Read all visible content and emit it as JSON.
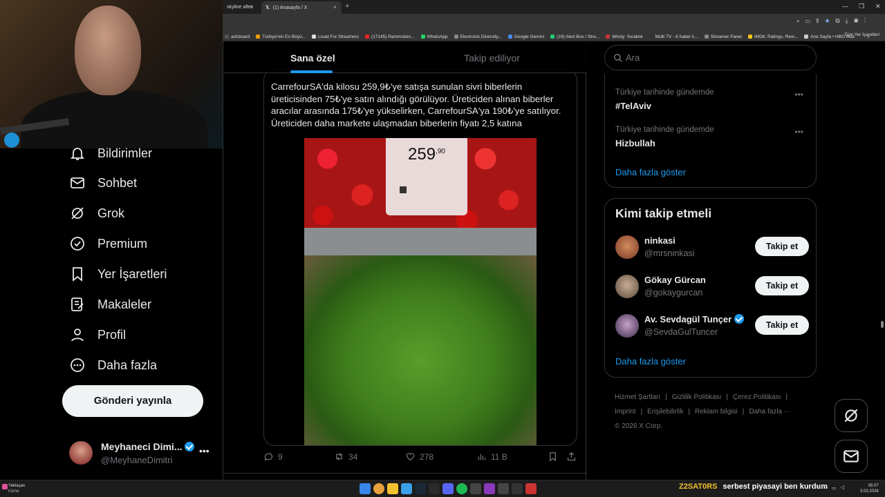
{
  "browser": {
    "tabs": [
      {
        "label": "skyline after",
        "close": "×"
      },
      {
        "label": "(1) Anasayfa / X",
        "close": "×"
      }
    ],
    "new_tab": "+",
    "bookmarks": [
      {
        "label": "ashboard",
        "color": "#555"
      },
      {
        "label": "Türkiye'nin En Büyü...",
        "color": "#f0a000"
      },
      {
        "label": "Livad For Streamers",
        "color": "#ddd"
      },
      {
        "label": "(17145) Rammstein...",
        "color": "#e22"
      },
      {
        "label": "WhatsApp",
        "color": "#25d366"
      },
      {
        "label": "Electronic Diversity...",
        "color": "#888"
      },
      {
        "label": "Google Gemini",
        "color": "#4a8af4"
      },
      {
        "label": "(19) Alert Box / Stre...",
        "color": "#2c7"
      },
      {
        "label": "Windy: Sıcaklık",
        "color": "#c33"
      },
      {
        "label": "Multi TV - 6 haber k...",
        "color": "#333"
      },
      {
        "label": "Streamer Panel",
        "color": "#888"
      },
      {
        "label": "IMDb: Ratings, Revi...",
        "color": "#f5c518"
      },
      {
        "label": "Ana Sayfa • HBO Max",
        "color": "#ccc"
      },
      {
        "label": "»",
        "color": "transparent"
      }
    ],
    "bookmarks_right": "Tüm Yer İşaretleri"
  },
  "sidebar": {
    "items": [
      {
        "label": "Bildirimler",
        "icon": "bell-icon"
      },
      {
        "label": "Sohbet",
        "icon": "mail-icon"
      },
      {
        "label": "Grok",
        "icon": "grok-icon"
      },
      {
        "label": "Premium",
        "icon": "verified-badge-icon"
      },
      {
        "label": "Yer İşaretleri",
        "icon": "bookmark-icon"
      },
      {
        "label": "Makaleler",
        "icon": "article-icon"
      },
      {
        "label": "Profil",
        "icon": "profile-icon"
      },
      {
        "label": "Daha fazla",
        "icon": "more-circle-icon"
      }
    ],
    "post_button": "Gönderi yayınla",
    "account": {
      "name": "Meyhaneci Dimi...",
      "handle": "@MeyhaneDimitri",
      "more": "•••"
    }
  },
  "feed": {
    "tabs": [
      {
        "label": "Sana özel",
        "active": true
      },
      {
        "label": "Takip ediliyor",
        "active": false
      }
    ],
    "quote_text": "CarrefourSA'da kilosu 259,9₺'ye satışa sunulan sivri biberlerin üreticisinden 75₺'ye satın alındığı görülüyor. Üreticiden alınan biberler aracılar arasında 175₺'ye yükselirken, CarrefourSA'ya 190₺'ye satılıyor. Üreticiden daha markete ulaşmadan biberlerin fiyatı 2,5 katına",
    "price_tag": {
      "main": "259",
      "cents": ",90"
    },
    "actions": {
      "replies": "9",
      "reposts": "34",
      "likes": "278",
      "views": "11 B"
    }
  },
  "right": {
    "search_placeholder": "Ara",
    "trends": [
      {
        "context": "Türkiye tarihinde gündemde",
        "name": "#TelAviv",
        "more": "•••"
      },
      {
        "context": "Türkiye tarihinde gündemde",
        "name": "Hizbullah",
        "more": "•••"
      }
    ],
    "trends_show_more": "Daha fazla göster",
    "who_to_follow": {
      "title": "Kimi takip etmeli",
      "users": [
        {
          "name": "ninkasi",
          "handle": "@mrsninkasi",
          "verified": false,
          "button": "Takip et",
          "avatar_color": "#b46a4a"
        },
        {
          "name": "Gökay Gürcan",
          "handle": "@gokaygurcan",
          "verified": false,
          "button": "Takip et",
          "avatar_color": "#8a7a6a"
        },
        {
          "name": "Av. Sevdagül Tunçer",
          "handle": "@SevdaGulTuncer",
          "verified": true,
          "button": "Takip et",
          "avatar_color": "#6a5a7a"
        }
      ],
      "show_more": "Daha fazla göster"
    },
    "footer": {
      "links": [
        "Hizmet Şartları",
        "|",
        "Gizlilik Politikası",
        "|",
        "Çerez Politikası",
        "|",
        "Imprint",
        "|",
        "Erişilebilirlik",
        "|",
        "Reklam bilgisi",
        "|",
        "Daha fazla ···"
      ],
      "copyright": "© 2026 X Corp."
    }
  },
  "taskbar": {
    "weather_title": "Yaklaşan",
    "weather_sub": "Kârlar",
    "ticker_user": "Z2SAT0RS",
    "ticker_msg": "serbest piyasayi ben kurdum",
    "time": "05:07",
    "date": "3.03.2026"
  },
  "colors": {
    "accent": "#1d9bf0",
    "background": "#000000",
    "border": "#2f3336",
    "muted": "#71767b"
  }
}
